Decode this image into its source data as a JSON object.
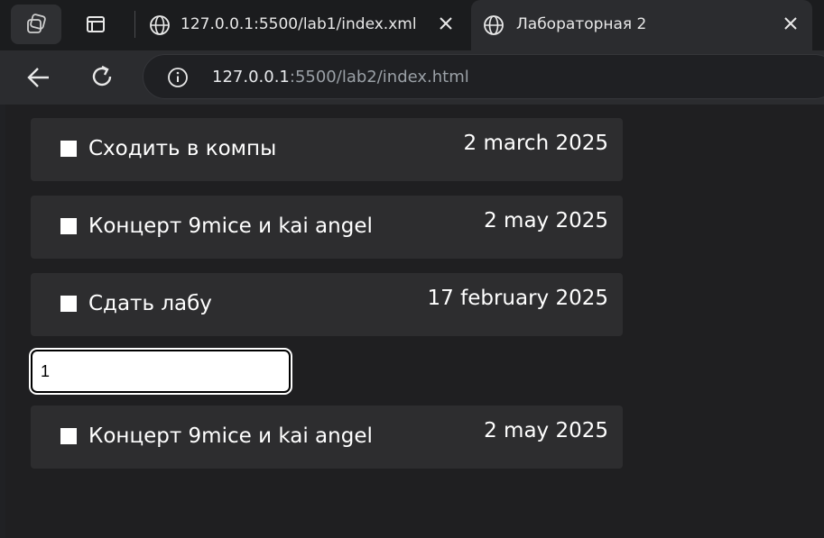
{
  "browser": {
    "tabs": [
      {
        "title": "127.0.0.1:5500/lab1/index.xml",
        "active": false
      },
      {
        "title": "Лабораторная 2",
        "active": true
      }
    ],
    "address": {
      "host": "127.0.0.1",
      "path": ":5500/lab2/index.html"
    },
    "icons": {
      "workspaces": "workspaces-icon",
      "tab_actions": "tab-actions-icon",
      "tab_favicon": "globe-icon",
      "tab_close": "close-icon",
      "back": "back-arrow-icon",
      "reload": "reload-icon",
      "site_info": "info-icon"
    }
  },
  "page": {
    "background": "#1f1f21",
    "tasks_top": [
      {
        "text": "Сходить в компы",
        "date": "2 march 2025",
        "checked": false
      },
      {
        "text": "Концерт 9mice и kai angel",
        "date": "2 may 2025",
        "checked": false
      },
      {
        "text": "Сдать лабу",
        "date": "17 february 2025",
        "checked": false
      }
    ],
    "input_value": "1",
    "tasks_bottom": [
      {
        "text": "Концерт 9mice и kai angel",
        "date": "2 may 2025",
        "checked": false
      }
    ]
  }
}
